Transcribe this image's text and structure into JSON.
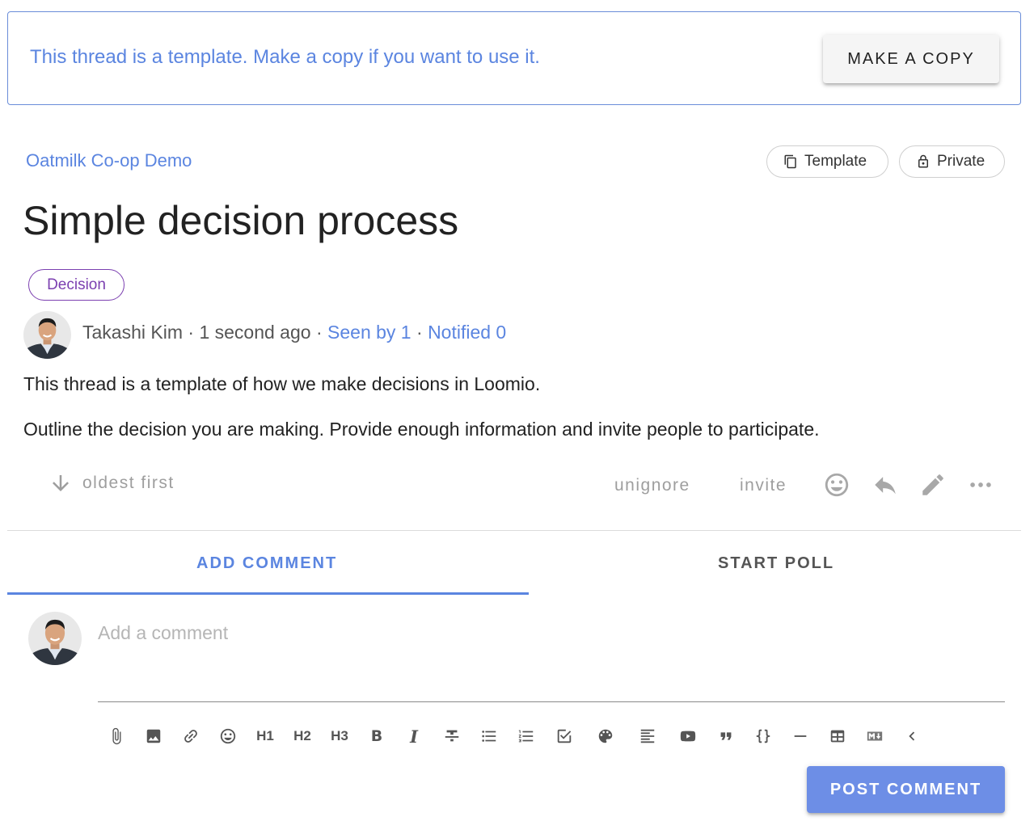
{
  "banner": {
    "message": "This thread is a template. Make a copy if you want to use it.",
    "make_copy_label": "MAKE A COPY"
  },
  "thread": {
    "group_name": "Oatmilk Co-op Demo",
    "chips": {
      "template": "Template",
      "private": "Private"
    },
    "title": "Simple decision process",
    "tag": "Decision",
    "author": "Takashi Kim",
    "time": "1 second ago",
    "seen_by": "Seen by 1",
    "notified": "Notified 0",
    "body": [
      "This thread is a template of how we make decisions in Loomio.",
      "Outline the decision you are making. Provide enough information and invite people to participate."
    ]
  },
  "actions": {
    "sort_label": "oldest first",
    "unignore": "unignore",
    "invite": "invite",
    "icons": [
      "emoji-icon",
      "reply-icon",
      "edit-icon",
      "more-icon"
    ]
  },
  "tabs": {
    "add_comment": "ADD COMMENT",
    "start_poll": "START POLL"
  },
  "comment": {
    "placeholder": "Add a comment",
    "post_label": "POST COMMENT"
  },
  "toolbar": {
    "h1": "H1",
    "h2": "H2",
    "h3": "H3",
    "bold": "B",
    "italic": "I"
  },
  "colors": {
    "accent": "#5b85e0",
    "tag": "#7b3fb0",
    "post_button": "#6d8ee6"
  }
}
